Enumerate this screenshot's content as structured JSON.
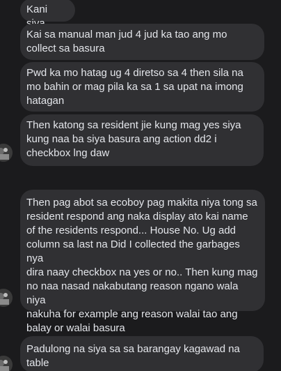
{
  "messages": [
    {
      "text": "Kani siya"
    },
    {
      "text": "Kai sa manual man jud 4 jud ka tao ang mo\ncollect sa basura"
    },
    {
      "text": "Pwd ka mo hatag ug 4 diretso sa 4 then sila na\nmo bahin or mag pila ka sa 1 sa upat na imong\nhatagan"
    },
    {
      "text": "Then katong sa resident jie kung mag yes siya\nkung naa ba siya basura ang action dd2 i\ncheckbox lng daw"
    },
    {
      "text": "Then pag abot sa ecoboy pag makita niya tong sa\nresident respond ang naka display ato kai name\nof the residents respond... House No. Ug add\ncolumn sa last na Did I collected the garbages nya\ndira naay checkbox na yes or no.. Then kung mag\nno naa nasad nakabutang reason ngano wala niya\nnakuha for example ang reason walai tao ang\nbalay or walai basura"
    },
    {
      "text": "Padulong na siya sa sa barangay kagawad na\ntable"
    }
  ],
  "colors": {
    "background": "#1b1b1d",
    "bubble": "#303033",
    "text": "#e4e6eb"
  },
  "icons": [
    "sender-avatar-icon"
  ]
}
